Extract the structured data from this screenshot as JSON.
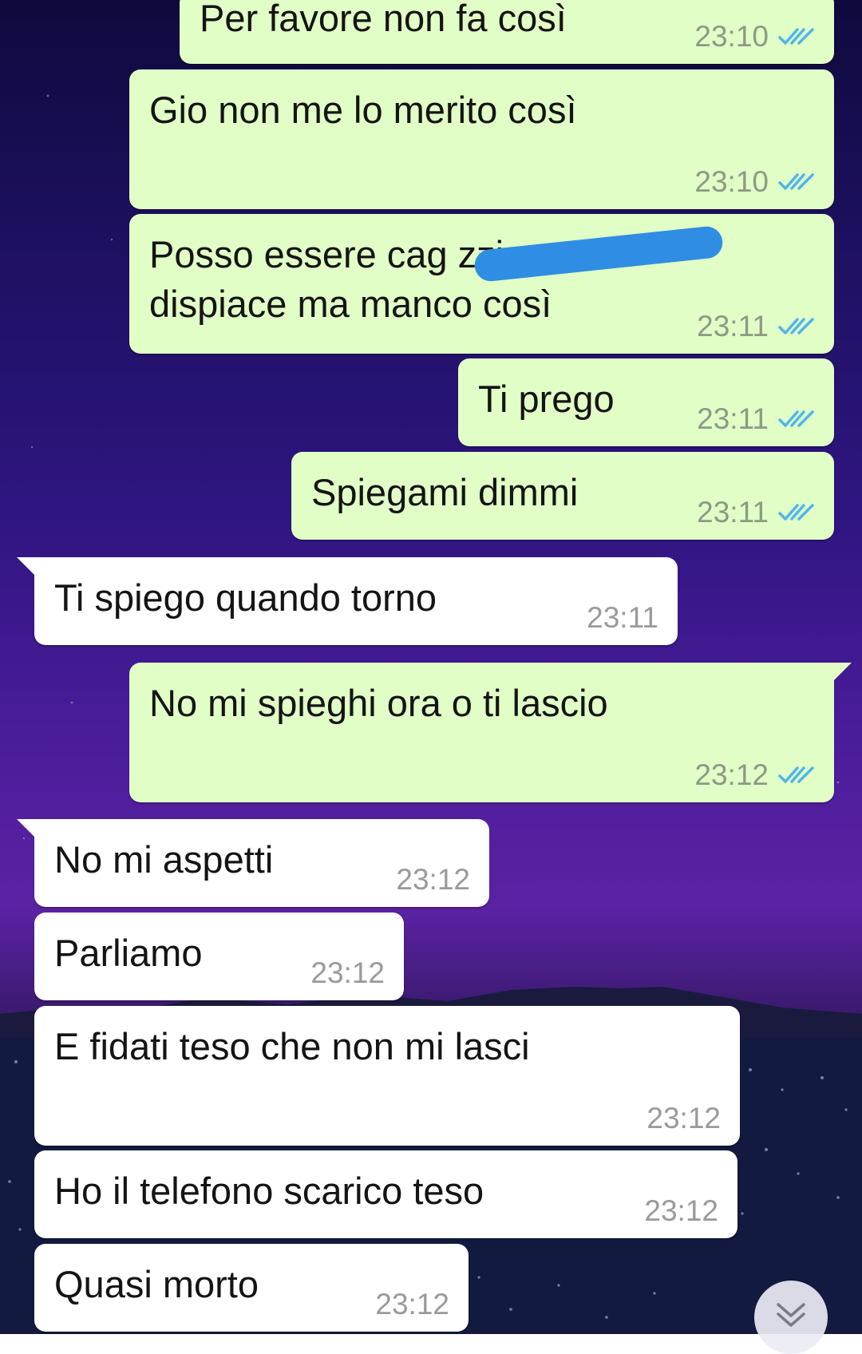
{
  "messages": [
    {
      "text": "Per favore non fa così",
      "time": "23:10",
      "direction": "out"
    },
    {
      "text": "Gio non me lo merito così",
      "time": "23:10",
      "direction": "out"
    },
    {
      "text": "Posso essere cag        zzi e mi\ndispiace ma manco così",
      "time": "23:11",
      "direction": "out"
    },
    {
      "text": "Ti prego",
      "time": "23:11",
      "direction": "out"
    },
    {
      "text": "Spiegami dimmi",
      "time": "23:11",
      "direction": "out"
    },
    {
      "text": "Ti spiego quando torno",
      "time": "23:11",
      "direction": "in"
    },
    {
      "text": "No mi spieghi ora o ti lascio",
      "time": "23:12",
      "direction": "out"
    },
    {
      "text": "No mi aspetti",
      "time": "23:12",
      "direction": "in"
    },
    {
      "text": "Parliamo",
      "time": "23:12",
      "direction": "in"
    },
    {
      "text": "E fidati teso che non mi lasci",
      "time": "23:12",
      "direction": "in"
    },
    {
      "text": "Ho il telefono scarico teso",
      "time": "23:12",
      "direction": "in"
    },
    {
      "text": "Quasi morto",
      "time": "23:12",
      "direction": "in"
    }
  ],
  "icons": {
    "read_receipt": "double-check-icon",
    "scroll_down": "chevron-double-down-icon"
  },
  "colors": {
    "outgoing_bubble": "#e1fec6",
    "incoming_bubble": "#ffffff",
    "read_tick": "#4fb6ec",
    "wallpaper_top": "#0e0a3c",
    "wallpaper_mid": "#4a1c9a"
  }
}
